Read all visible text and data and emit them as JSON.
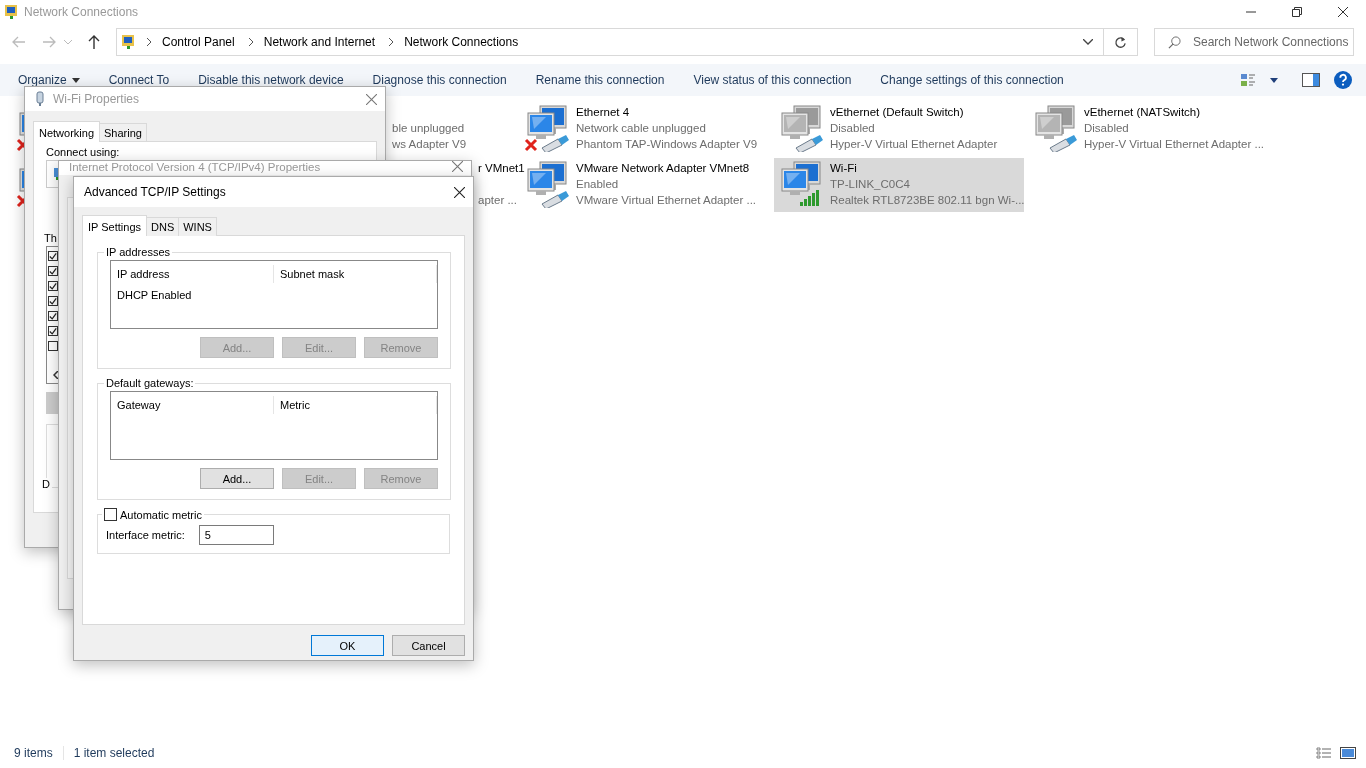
{
  "window": {
    "title": "Network Connections"
  },
  "breadcrumb": [
    "Control Panel",
    "Network and Internet",
    "Network Connections"
  ],
  "search": {
    "placeholder": "Search Network Connections"
  },
  "commands": [
    {
      "label": "Organize",
      "dropdown": true
    },
    {
      "label": "Connect To",
      "dropdown": false
    },
    {
      "label": "Disable this network device",
      "dropdown": false
    },
    {
      "label": "Diagnose this connection",
      "dropdown": false
    },
    {
      "label": "Rename this connection",
      "dropdown": false
    },
    {
      "label": "View status of this connection",
      "dropdown": false
    },
    {
      "label": "Change settings of this connection",
      "dropdown": false
    }
  ],
  "connections": [
    {
      "kind": "covered",
      "unplugged": true,
      "disabled": false,
      "selected": false
    },
    {
      "kind": "covered",
      "unplugged": true,
      "disabled": false,
      "selected": false
    },
    {
      "kind": "clipped",
      "status": "ble unplugged",
      "device": "ws Adapter V9",
      "selected": false
    },
    {
      "kind": "clipped",
      "name": "r VMnet1",
      "device": "apter ...",
      "selected": false
    },
    {
      "kind": "adapter",
      "name": "Ethernet 4",
      "status": "Network cable unplugged",
      "device": "Phantom TAP-Windows Adapter V9",
      "unplugged": true,
      "wireless": false,
      "disabled": false,
      "selected": false
    },
    {
      "kind": "adapter",
      "name": "VMware Network Adapter VMnet8",
      "status": "Enabled",
      "device": "VMware Virtual Ethernet Adapter ...",
      "unplugged": false,
      "wireless": false,
      "disabled": false,
      "selected": false
    },
    {
      "kind": "adapter",
      "name": "vEthernet (Default Switch)",
      "status": "Disabled",
      "device": "Hyper-V Virtual Ethernet Adapter",
      "unplugged": false,
      "wireless": false,
      "disabled": true,
      "selected": false
    },
    {
      "kind": "adapter",
      "name": "Wi-Fi",
      "status": "TP-LINK_C0C4",
      "device": "Realtek RTL8723BE 802.11 bgn Wi-...",
      "unplugged": false,
      "wireless": true,
      "disabled": false,
      "selected": true
    },
    {
      "kind": "adapter",
      "name": "vEthernet (NATSwitch)",
      "status": "Disabled",
      "device": "Hyper-V Virtual Ethernet Adapter ...",
      "unplugged": false,
      "wireless": false,
      "disabled": true,
      "selected": false
    }
  ],
  "status_bar": {
    "count": "9 items",
    "selection": "1 item selected"
  },
  "wifi_properties": {
    "title": "Wi-Fi Properties",
    "tabs": [
      {
        "label": "Networking",
        "selected": true
      },
      {
        "label": "Sharing",
        "selected": false
      }
    ],
    "connect_label": "Connect using:",
    "list_label": "Th",
    "group_label": "D",
    "components": [
      {
        "checked": true
      },
      {
        "checked": true
      },
      {
        "checked": true
      },
      {
        "checked": true
      },
      {
        "checked": true
      },
      {
        "checked": true
      },
      {
        "checked": false
      }
    ]
  },
  "ipv4_properties": {
    "title": "Internet Protocol Version 4 (TCP/IPv4) Properties"
  },
  "advanced": {
    "title": "Advanced TCP/IP Settings",
    "tabs": [
      {
        "label": "IP Settings",
        "selected": true
      },
      {
        "label": "DNS",
        "selected": false
      },
      {
        "label": "WINS",
        "selected": false
      }
    ],
    "ip_group": {
      "label": "IP addresses",
      "columns": [
        "IP address",
        "Subnet mask"
      ],
      "rows": [
        "DHCP Enabled"
      ],
      "buttons": [
        {
          "label": "Add...",
          "disabled": true
        },
        {
          "label": "Edit...",
          "disabled": true
        },
        {
          "label": "Remove",
          "disabled": true
        }
      ]
    },
    "gateway_group": {
      "label": "Default gateways:",
      "columns": [
        "Gateway",
        "Metric"
      ],
      "buttons": [
        {
          "label": "Add...",
          "disabled": false
        },
        {
          "label": "Edit...",
          "disabled": true
        },
        {
          "label": "Remove",
          "disabled": true
        }
      ]
    },
    "automatic_metric": {
      "label": "Automatic metric",
      "checked": false
    },
    "interface_metric": {
      "label": "Interface metric:",
      "value": "5"
    },
    "buttons": [
      {
        "label": "OK",
        "default": true
      },
      {
        "label": "Cancel",
        "default": false
      }
    ]
  }
}
